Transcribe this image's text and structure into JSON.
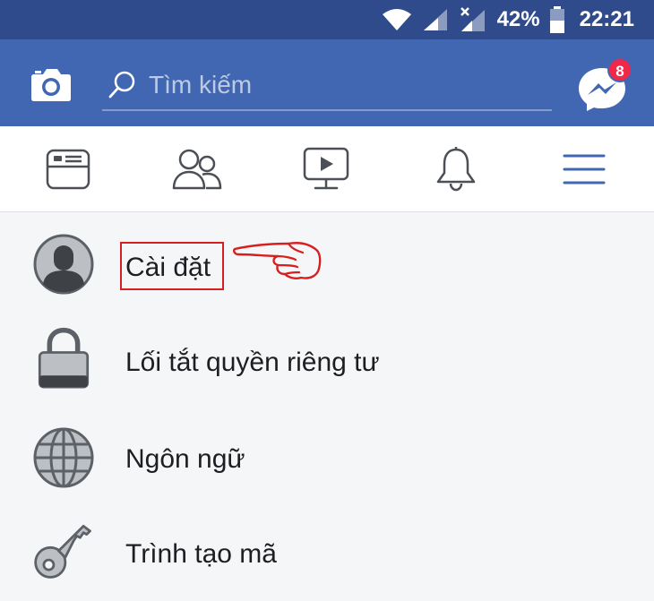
{
  "status_bar": {
    "battery": "42%",
    "time": "22:21"
  },
  "top_bar": {
    "search_placeholder": "Tìm kiếm",
    "messenger_badge": "8",
    "color": "#4267b2"
  },
  "tabs": [
    {
      "icon": "news-feed-icon"
    },
    {
      "icon": "friends-icon"
    },
    {
      "icon": "watch-video-icon"
    },
    {
      "icon": "notifications-bell-icon"
    },
    {
      "icon": "menu-hamburger-icon",
      "active": true
    }
  ],
  "menu": {
    "items": [
      {
        "label": "Cài đặt",
        "icon": "profile-avatar-icon"
      },
      {
        "label": "Lối tắt quyền riêng tư",
        "icon": "lock-icon"
      },
      {
        "label": "Ngôn ngữ",
        "icon": "globe-icon"
      },
      {
        "label": "Trình tạo mã",
        "icon": "key-icon"
      }
    ]
  }
}
